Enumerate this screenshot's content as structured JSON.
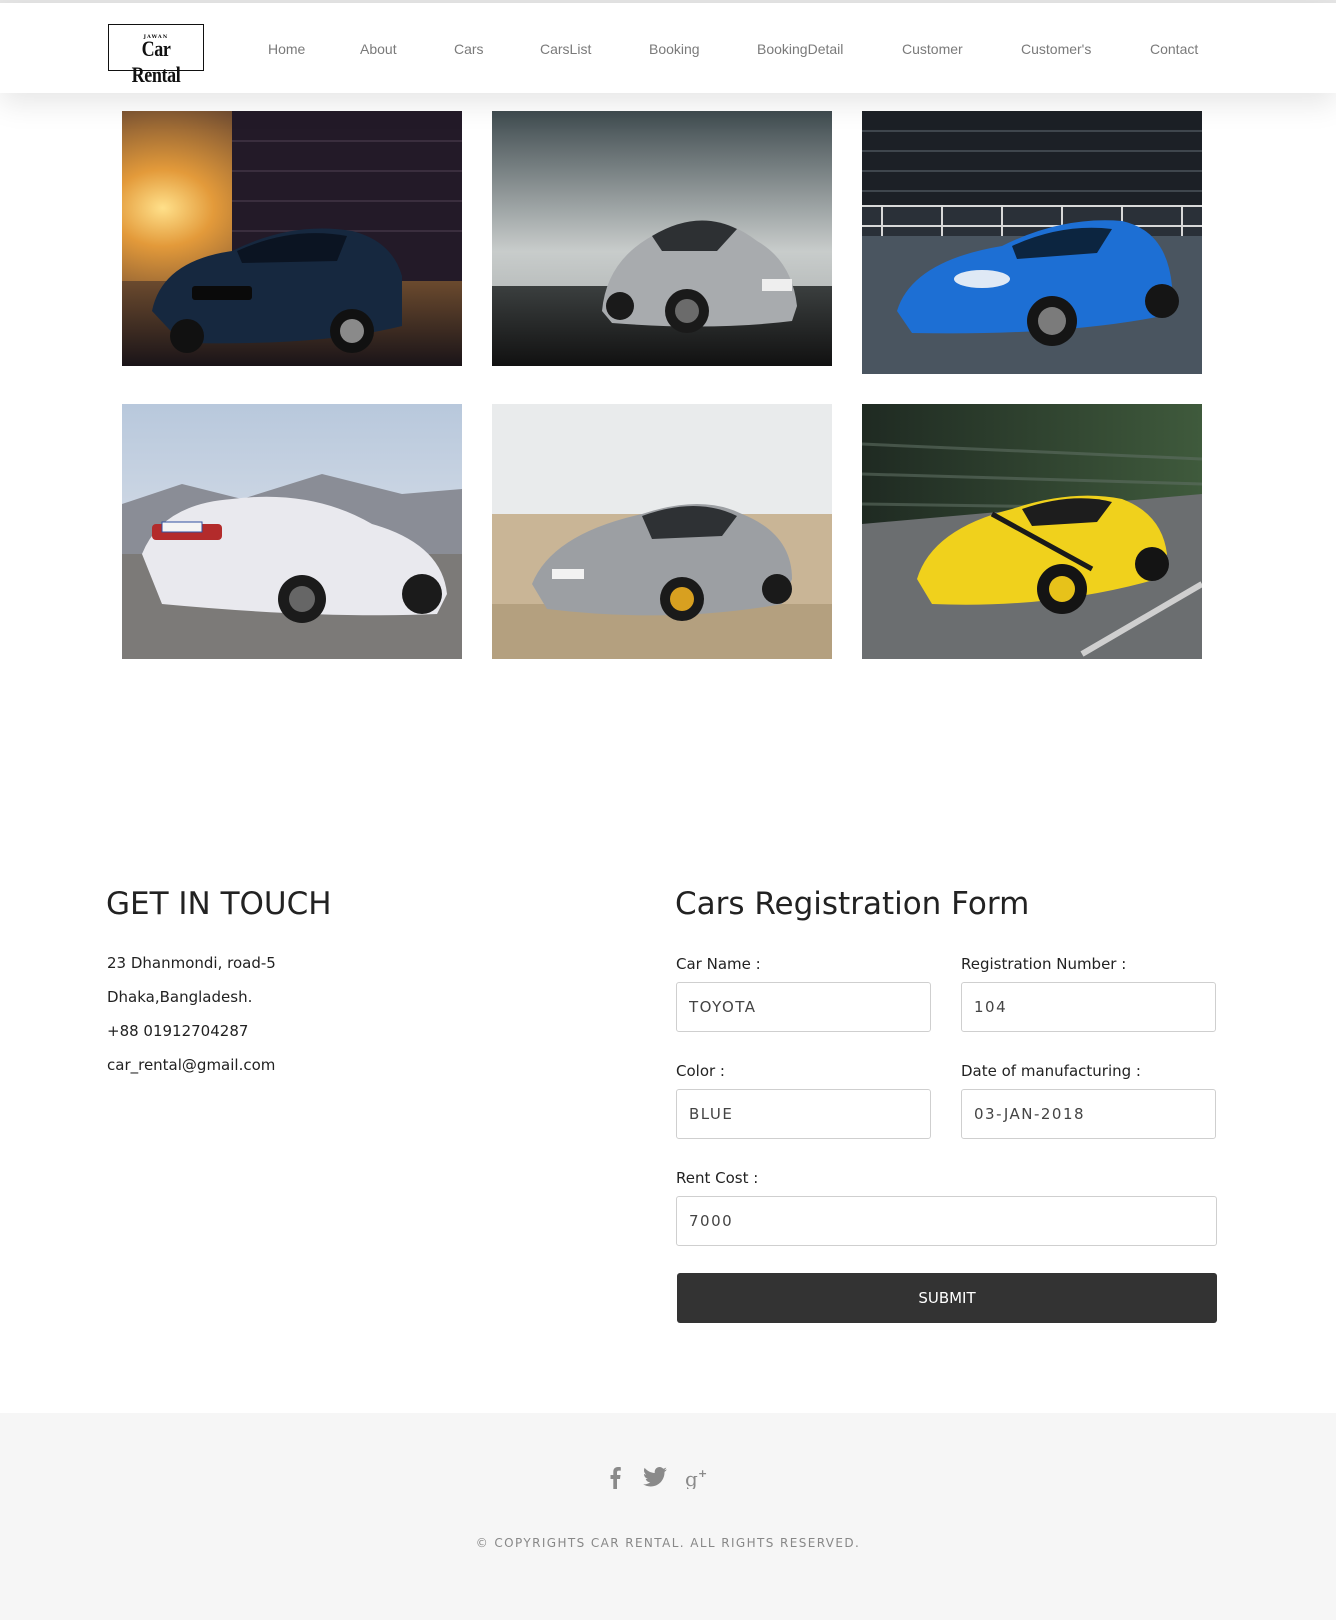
{
  "brand": {
    "logo_small": "JAWAN",
    "logo_main": "Car Rental"
  },
  "nav": [
    "Home",
    "About",
    "Cars",
    "CarsList",
    "Booking",
    "BookingDetail",
    "Customer",
    "Customer's",
    "Contact"
  ],
  "gallery": [
    {
      "name": "dark-blue-coupe-at-sunset",
      "color": "#16283f"
    },
    {
      "name": "silver-sports-car-on-road",
      "color": "#a8abae"
    },
    {
      "name": "blue-sports-car-on-track",
      "color": "#1d6fd4"
    },
    {
      "name": "white-convertible-in-mountains",
      "color": "#e9e9ee"
    },
    {
      "name": "silver-sedan-in-desert",
      "color": "#9c9fa3"
    },
    {
      "name": "yellow-sports-car-in-motion",
      "color": "#f0d11c"
    }
  ],
  "contact": {
    "title": "GET IN TOUCH",
    "address_line1": "23 Dhanmondi, road-5",
    "address_line2": "Dhaka,Bangladesh.",
    "phone": "+88 01912704287",
    "email": "car_rental@gmail.com"
  },
  "form": {
    "title": "Cars Registration Form",
    "car_name_label": "Car Name :",
    "car_name_value": "TOYOTA",
    "reg_number_label": "Registration Number :",
    "reg_number_value": "104",
    "color_label": "Color :",
    "color_value": "BLUE",
    "manufacture_date_label": "Date of manufacturing :",
    "manufacture_date_value": "03-JAN-2018",
    "rent_cost_label": "Rent Cost :",
    "rent_cost_value": "7000",
    "submit_label": "SUBMIT"
  },
  "footer": {
    "social": [
      "facebook-icon",
      "twitter-icon",
      "google-plus-icon"
    ],
    "copyright": "© COPYRIGHTS CAR RENTAL. ALL RIGHTS RESERVED."
  }
}
